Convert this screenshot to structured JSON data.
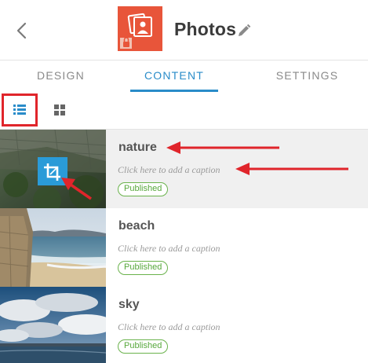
{
  "header": {
    "title": "Photos",
    "icons": {
      "back": "chevron-left-icon",
      "app": "photos-lock-icon",
      "edit": "pencil-icon"
    }
  },
  "tabs": [
    {
      "label": "DESIGN",
      "active": false
    },
    {
      "label": "CONTENT",
      "active": true
    },
    {
      "label": "SETTINGS",
      "active": false
    }
  ],
  "toolbar": {
    "list_view_icon": "list-view-icon",
    "grid_view_icon": "grid-view-icon",
    "selected": "list"
  },
  "items": [
    {
      "title": "nature",
      "caption": "Click here to add a caption",
      "status": "Published"
    },
    {
      "title": "beach",
      "caption": "Click here to add a caption",
      "status": "Published"
    },
    {
      "title": "sky",
      "caption": "Click here to add a caption",
      "status": "Published"
    }
  ],
  "colors": {
    "accent": "#2a8cc9",
    "brand": "#e8553a",
    "published": "#57a83c",
    "annotation": "#e0252b"
  }
}
